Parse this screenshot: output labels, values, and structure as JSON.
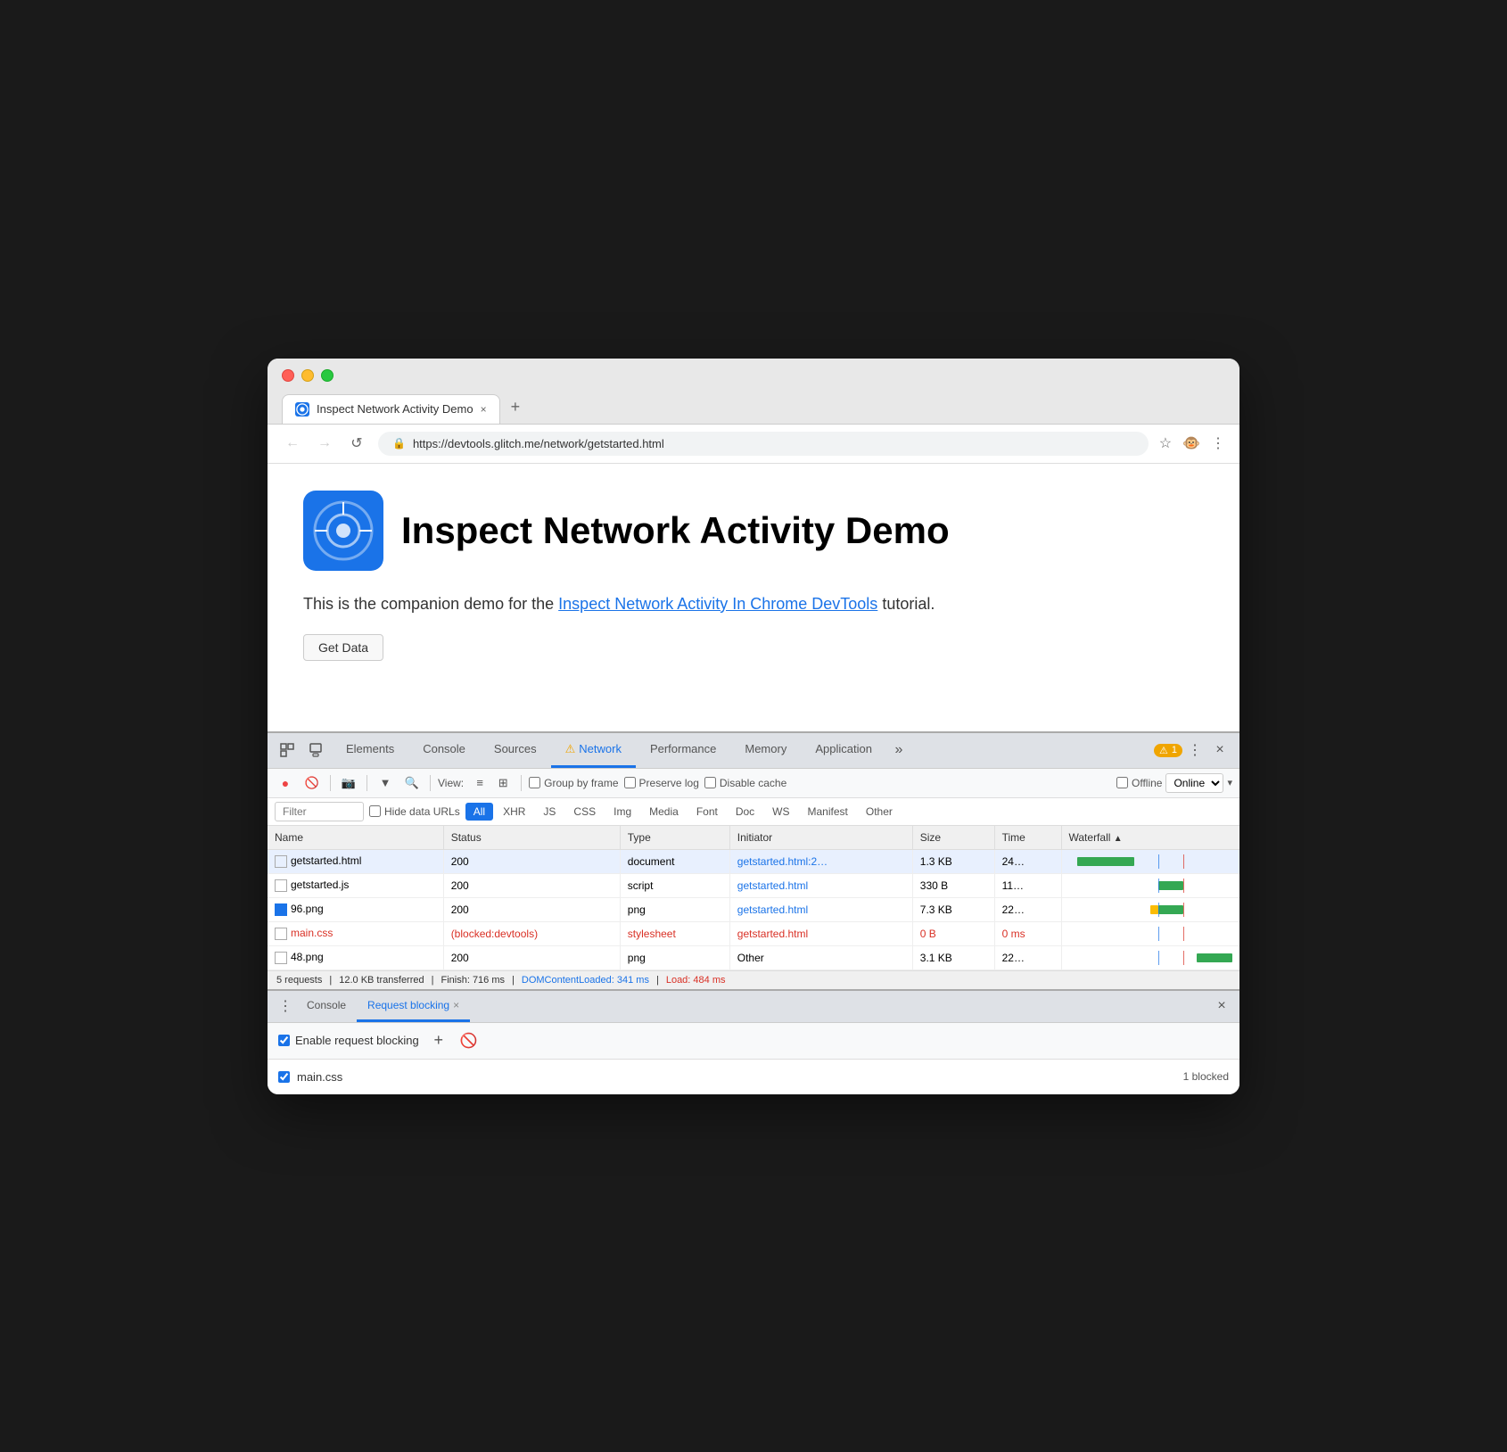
{
  "browser": {
    "tab_title": "Inspect Network Activity Demo",
    "tab_favicon": "chrome-icon",
    "tab_close": "×",
    "tab_new": "+",
    "nav_back": "←",
    "nav_forward": "→",
    "nav_refresh": "↺",
    "address_lock": "🔒",
    "address_url": "https://devtools.glitch.me/network/getstarted.html",
    "bookmark_icon": "☆",
    "profile_icon": "🐵",
    "menu_icon": "⋮"
  },
  "page": {
    "title": "Inspect Network Activity Demo",
    "description_text": "This is the companion demo for the",
    "link_text": "Inspect Network Activity In Chrome DevTools",
    "description_suffix": " tutorial.",
    "get_data_label": "Get Data"
  },
  "devtools": {
    "tabs": [
      {
        "id": "elements",
        "label": "Elements",
        "active": false
      },
      {
        "id": "console",
        "label": "Console",
        "active": false
      },
      {
        "id": "sources",
        "label": "Sources",
        "active": false
      },
      {
        "id": "network",
        "label": "Network",
        "active": true,
        "warning": true
      },
      {
        "id": "performance",
        "label": "Performance",
        "active": false
      },
      {
        "id": "memory",
        "label": "Memory",
        "active": false
      },
      {
        "id": "application",
        "label": "Application",
        "active": false
      }
    ],
    "more_tabs": "»",
    "badge_warning": "⚠",
    "badge_count": "1",
    "more_btn": "⋮",
    "close_btn": "×",
    "inspect_icon": "⬚",
    "device_icon": "▭"
  },
  "network": {
    "toolbar": {
      "record_icon": "●",
      "clear_icon": "🚫",
      "camera_icon": "📷",
      "filter_icon": "▼",
      "search_icon": "🔍",
      "view_label": "View:",
      "list_view_icon": "≡",
      "tree_view_icon": "⊞",
      "group_by_frame_label": "Group by frame",
      "preserve_log_label": "Preserve log",
      "disable_cache_label": "Disable cache",
      "offline_label": "Offline",
      "online_label": "Online",
      "dropdown_icon": "▾"
    },
    "filter": {
      "placeholder": "Filter",
      "hide_data_urls_label": "Hide data URLs",
      "types": [
        "All",
        "XHR",
        "JS",
        "CSS",
        "Img",
        "Media",
        "Font",
        "Doc",
        "WS",
        "Manifest",
        "Other"
      ],
      "active_type": "All"
    },
    "table": {
      "columns": [
        "Name",
        "Status",
        "Type",
        "Initiator",
        "Size",
        "Time",
        "Waterfall"
      ],
      "rows": [
        {
          "name": "getstarted.html",
          "status": "200",
          "type": "document",
          "initiator": "getstarted.html:2…",
          "initiator_link": true,
          "size": "1.3 KB",
          "time": "24…",
          "wf_type": "green_bar",
          "wf_offset": "0",
          "icon": "doc"
        },
        {
          "name": "getstarted.js",
          "status": "200",
          "type": "script",
          "initiator": "getstarted.html",
          "initiator_link": true,
          "size": "330 B",
          "time": "11…",
          "wf_type": "green_small",
          "wf_offset": "60",
          "icon": "doc"
        },
        {
          "name": "96.png",
          "status": "200",
          "type": "png",
          "initiator": "getstarted.html",
          "initiator_link": true,
          "size": "7.3 KB",
          "time": "22…",
          "wf_type": "orange_green",
          "wf_offset": "55",
          "icon": "img"
        },
        {
          "name": "main.css",
          "status": "(blocked:devtools)",
          "type": "stylesheet",
          "initiator": "getstarted.html",
          "initiator_link": true,
          "initiator_blocked": true,
          "size": "0 B",
          "time": "0 ms",
          "wf_type": "none",
          "wf_offset": "0",
          "icon": "doc",
          "blocked": true
        },
        {
          "name": "48.png",
          "status": "200",
          "type": "png",
          "initiator": "Other",
          "initiator_link": false,
          "size": "3.1 KB",
          "time": "22…",
          "wf_type": "green_end",
          "wf_offset": "80",
          "icon": "doc"
        }
      ]
    },
    "status_bar": {
      "requests": "5 requests",
      "transferred": "12.0 KB transferred",
      "finish": "Finish: 716 ms",
      "domcontent": "DOMContentLoaded: 341 ms",
      "load": "Load: 484 ms"
    }
  },
  "bottom_panel": {
    "tabs": [
      {
        "id": "console",
        "label": "Console",
        "active": false,
        "closeable": false
      },
      {
        "id": "request_blocking",
        "label": "Request blocking",
        "active": true,
        "closeable": true
      }
    ],
    "more_icon": "⋮",
    "close_icon": "×",
    "toolbar": {
      "enable_label": "Enable request blocking",
      "add_icon": "+",
      "block_icon": "🚫"
    },
    "blocked_items": [
      {
        "name": "main.css",
        "blocked_count": "1 blocked",
        "enabled": true
      }
    ]
  }
}
